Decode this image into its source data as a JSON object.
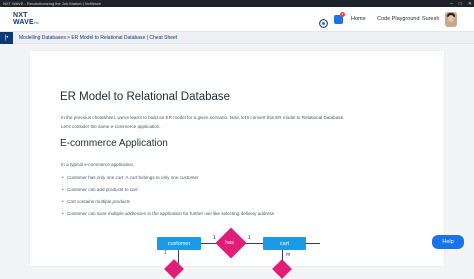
{
  "window": {
    "title": "NXT WAVE - Revolutionizing the Job Market | NxtWave",
    "controls": [
      "–",
      "□",
      "✕"
    ]
  },
  "nav": {
    "logo_line1": "NXT",
    "logo_line2": "WAVE",
    "logo_suffix": "TM",
    "notification_count": "1",
    "links": [
      "Home",
      "Code Playground"
    ],
    "user_name": "Suresh"
  },
  "breadcrumb": {
    "menu_icon": "|•",
    "text": "Modelling Databases > ER Model to Relational Database | Cheat Sheet"
  },
  "content": {
    "title": "ER Model to Relational Database",
    "intro_line1": "In the previous cheatsheet, we've learnt to build an ER model for a given scenario. Now, let's convert this ER model to Relational Database.",
    "intro_line2": "Let's consider the same e-commerce application.",
    "section_title": "E-commerce Application",
    "section_intro": "In a typical e-commerce application,",
    "bullets": [
      {
        "a": "Customer",
        "b": " has only one ",
        "c": "cart",
        "d": ". A ",
        "e": "cart",
        "f": " belongs to only one ",
        "g": "customer"
      },
      {
        "a": "Customer",
        "b": " can add products to ",
        "c": "cart",
        "d": "",
        "e": "",
        "f": "",
        "g": ""
      },
      {
        "a": "Cart",
        "b": " contains multiple ",
        "c": "products",
        "d": "",
        "e": "",
        "f": "",
        "g": ""
      },
      {
        "a": "Customer",
        "b": " can save multiple ",
        "c": "addresses",
        "d": " in the application for further use like selecting delivery address",
        "e": "",
        "f": "",
        "g": ""
      }
    ]
  },
  "diagram": {
    "entity_left": "customer",
    "relation": "has",
    "entity_right": "cart",
    "card_left": "1",
    "card_right": "1",
    "card_left_down": "1",
    "card_right_down": "m"
  },
  "help_label": "Help",
  "colors": {
    "brand_blue": "#0d3a75",
    "entity_blue": "#1a9be6",
    "relation_pink": "#e11d78",
    "button_blue": "#1a73e8"
  }
}
